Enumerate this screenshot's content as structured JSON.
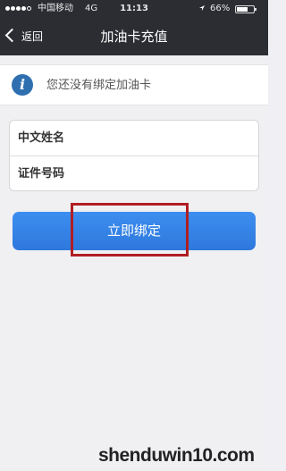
{
  "status_bar": {
    "carrier": "中国移动",
    "network": "4G",
    "time": "11:13",
    "battery_pct": "66%",
    "battery_level": 0.66,
    "signal_bars_filled": 4,
    "signal_bars_total": 5
  },
  "nav": {
    "back_label": "返回",
    "title": "加油卡充值"
  },
  "notice": {
    "icon": "info-icon",
    "text": "您还没有绑定加油卡"
  },
  "form": {
    "name_placeholder": "中文姓名",
    "id_placeholder": "证件号码"
  },
  "button": {
    "bind_label": "立即绑定"
  },
  "colors": {
    "nav_bg": "#2b2d33",
    "button_blue": "#3085e6",
    "highlight_red": "#b01e23",
    "info_blue": "#2f6fb0"
  },
  "watermark": "shenduwin10.com"
}
